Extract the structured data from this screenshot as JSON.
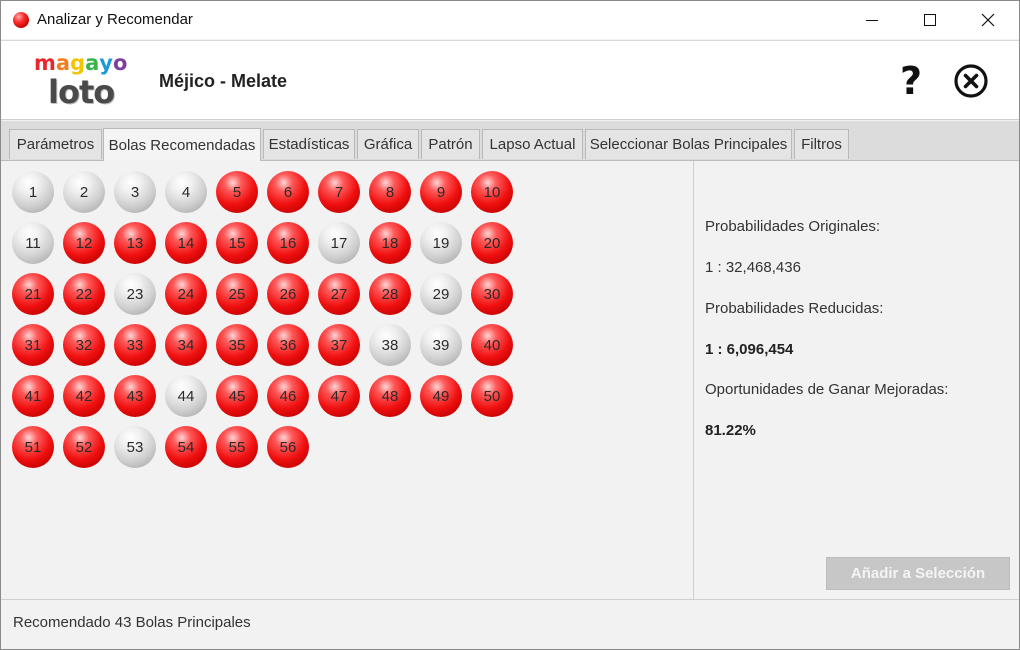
{
  "window": {
    "title": "Analizar y Recomendar"
  },
  "header": {
    "logo_top": "magayo",
    "logo_bottom": "loto",
    "logo_colors": [
      "#e8262b",
      "#f47d20",
      "#f2c500",
      "#3ab54a",
      "#1c9ad6",
      "#7b3fa0"
    ],
    "lottery_name": "Méjico - Melate",
    "help_symbol": "?"
  },
  "tabs": [
    {
      "label": "Parámetros",
      "active": false
    },
    {
      "label": "Bolas Recomendadas",
      "active": true
    },
    {
      "label": "Estadísticas",
      "active": false
    },
    {
      "label": "Gráfica",
      "active": false
    },
    {
      "label": "Patrón",
      "active": false
    },
    {
      "label": "Lapso Actual",
      "active": false
    },
    {
      "label": "Seleccionar Bolas Principales",
      "active": false
    },
    {
      "label": "Filtros",
      "active": false
    }
  ],
  "balls": {
    "colors": {
      "red": "#f01010",
      "gray": "#cfcfcf"
    },
    "items": [
      {
        "n": "1",
        "c": "gray"
      },
      {
        "n": "2",
        "c": "gray"
      },
      {
        "n": "3",
        "c": "gray"
      },
      {
        "n": "4",
        "c": "gray"
      },
      {
        "n": "5",
        "c": "red"
      },
      {
        "n": "6",
        "c": "red"
      },
      {
        "n": "7",
        "c": "red"
      },
      {
        "n": "8",
        "c": "red"
      },
      {
        "n": "9",
        "c": "red"
      },
      {
        "n": "10",
        "c": "red"
      },
      {
        "n": "11",
        "c": "gray"
      },
      {
        "n": "12",
        "c": "red"
      },
      {
        "n": "13",
        "c": "red"
      },
      {
        "n": "14",
        "c": "red"
      },
      {
        "n": "15",
        "c": "red"
      },
      {
        "n": "16",
        "c": "red"
      },
      {
        "n": "17",
        "c": "gray"
      },
      {
        "n": "18",
        "c": "red"
      },
      {
        "n": "19",
        "c": "gray"
      },
      {
        "n": "20",
        "c": "red"
      },
      {
        "n": "21",
        "c": "red"
      },
      {
        "n": "22",
        "c": "red"
      },
      {
        "n": "23",
        "c": "gray"
      },
      {
        "n": "24",
        "c": "red"
      },
      {
        "n": "25",
        "c": "red"
      },
      {
        "n": "26",
        "c": "red"
      },
      {
        "n": "27",
        "c": "red"
      },
      {
        "n": "28",
        "c": "red"
      },
      {
        "n": "29",
        "c": "gray"
      },
      {
        "n": "30",
        "c": "red"
      },
      {
        "n": "31",
        "c": "red"
      },
      {
        "n": "32",
        "c": "red"
      },
      {
        "n": "33",
        "c": "red"
      },
      {
        "n": "34",
        "c": "red"
      },
      {
        "n": "35",
        "c": "red"
      },
      {
        "n": "36",
        "c": "red"
      },
      {
        "n": "37",
        "c": "red"
      },
      {
        "n": "38",
        "c": "gray"
      },
      {
        "n": "39",
        "c": "gray"
      },
      {
        "n": "40",
        "c": "red"
      },
      {
        "n": "41",
        "c": "red"
      },
      {
        "n": "42",
        "c": "red"
      },
      {
        "n": "43",
        "c": "red"
      },
      {
        "n": "44",
        "c": "gray"
      },
      {
        "n": "45",
        "c": "red"
      },
      {
        "n": "46",
        "c": "red"
      },
      {
        "n": "47",
        "c": "red"
      },
      {
        "n": "48",
        "c": "red"
      },
      {
        "n": "49",
        "c": "red"
      },
      {
        "n": "50",
        "c": "red"
      },
      {
        "n": "51",
        "c": "red"
      },
      {
        "n": "52",
        "c": "red"
      },
      {
        "n": "53",
        "c": "gray"
      },
      {
        "n": "54",
        "c": "red"
      },
      {
        "n": "55",
        "c": "red"
      },
      {
        "n": "56",
        "c": "red"
      }
    ]
  },
  "info": {
    "original_label": "Probabilidades Originales:",
    "original_value": "1 : 32,468,436",
    "reduced_label": "Probabilidades Reducidas:",
    "reduced_value": "1 : 6,096,454",
    "improved_label": "Oportunidades de Ganar Mejoradas:",
    "improved_value": "81.22%",
    "add_button_label": "Añadir a Selección"
  },
  "status": {
    "text": "Recomendado 43 Bolas Principales"
  }
}
